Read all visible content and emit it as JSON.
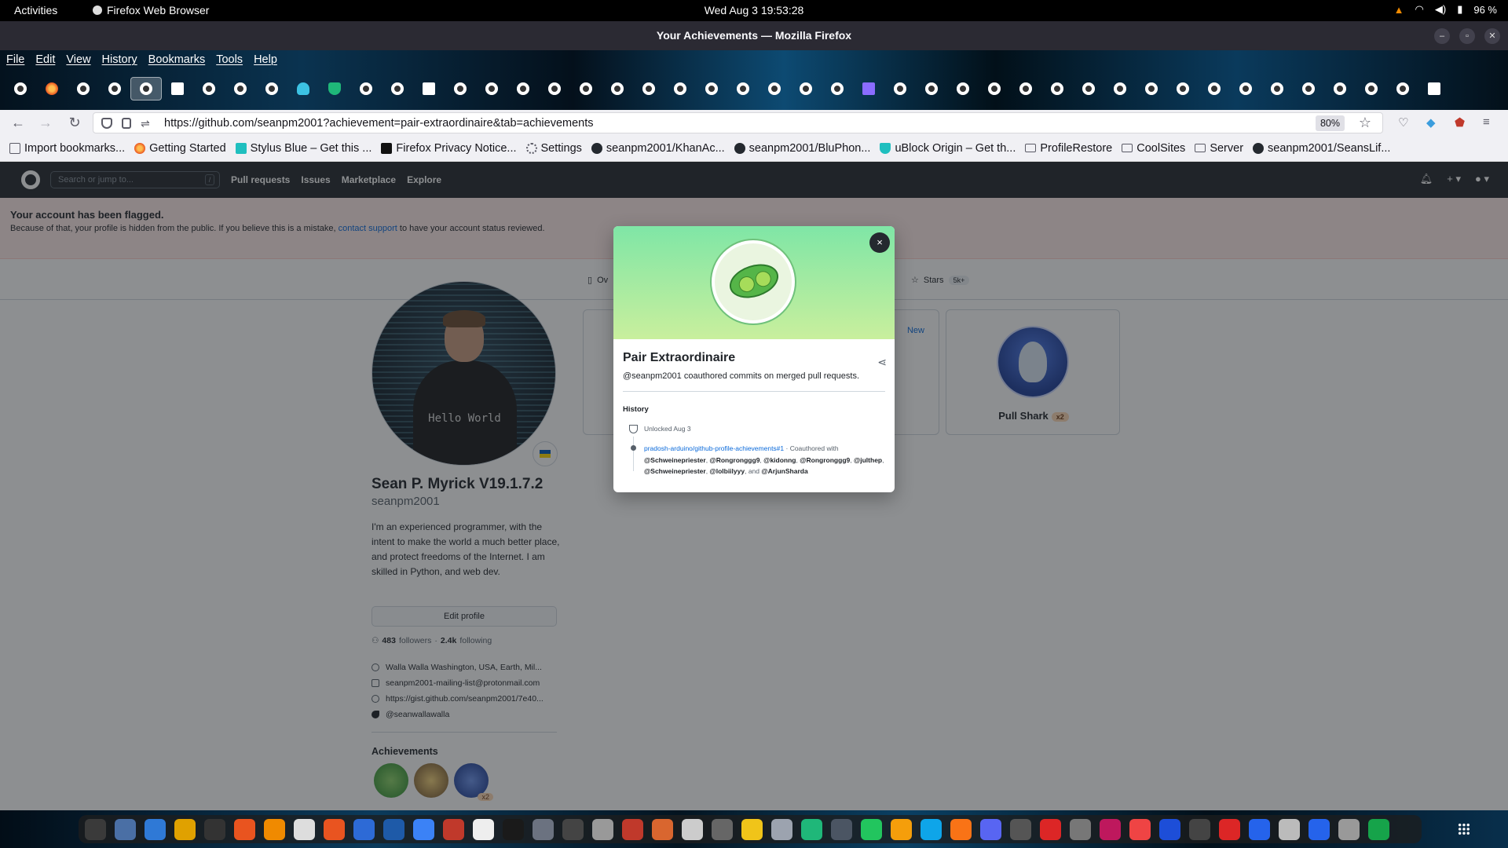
{
  "system": {
    "activities": "Activities",
    "app_name": "Firefox Web Browser",
    "clock": "Wed Aug 3  19:53:28",
    "battery": "96 %"
  },
  "window": {
    "title": "Your Achievements — Mozilla Firefox"
  },
  "menu": [
    "File",
    "Edit",
    "View",
    "History",
    "Bookmarks",
    "Tools",
    "Help"
  ],
  "tabs": [
    "github",
    "firefox",
    "github",
    "github",
    "github",
    "wikipedia",
    "github",
    "github",
    "puzzle",
    "cloud",
    "shield",
    "github",
    "github",
    "wikipedia",
    "globe",
    "github",
    "github",
    "github",
    "github",
    "github",
    "github",
    "github",
    "github",
    "github",
    "github",
    "github",
    "github",
    "mail",
    "github",
    "github",
    "github",
    "github",
    "github",
    "github",
    "github",
    "github",
    "github",
    "github",
    "github",
    "github",
    "github",
    "github",
    "github",
    "github",
    "github",
    "wikipedia"
  ],
  "active_tab_index": 4,
  "nav": {
    "url": "https://github.com/seanpm2001?achievement=pair-extraordinaire&tab=achievements",
    "zoom": "80%"
  },
  "bookmarks": [
    {
      "label": "Import bookmarks...",
      "icon": "import-icon"
    },
    {
      "label": "Getting Started",
      "icon": "firefox-icon"
    },
    {
      "label": "Stylus Blue – Get this ...",
      "icon": "stylus-icon"
    },
    {
      "label": "Firefox Privacy Notice...",
      "icon": "mozilla-icon"
    },
    {
      "label": "Settings",
      "icon": "gear-icon"
    },
    {
      "label": "seanpm2001/KhanAc...",
      "icon": "github-icon"
    },
    {
      "label": "seanpm2001/BluPhon...",
      "icon": "github-icon"
    },
    {
      "label": "uBlock Origin – Get th...",
      "icon": "ublock-icon"
    },
    {
      "label": "ProfileRestore",
      "icon": "folder-icon"
    },
    {
      "label": "CoolSites",
      "icon": "folder-icon"
    },
    {
      "label": "Server",
      "icon": "folder-icon"
    },
    {
      "label": "seanpm2001/SeansLif...",
      "icon": "github-icon"
    }
  ],
  "github": {
    "search_placeholder": "Search or jump to...",
    "search_key": "/",
    "nav": [
      "Pull requests",
      "Issues",
      "Marketplace",
      "Explore"
    ],
    "banner": {
      "title": "Your account has been flagged.",
      "text_before": "Because of that, your profile is hidden from the public. If you believe this is a mistake, ",
      "link": "contact support",
      "text_after": " to have your account status reviewed."
    },
    "tabs": {
      "overview": "Ov",
      "stars": "Stars",
      "stars_count": "5k+"
    },
    "profile": {
      "tee_text": "Hello World",
      "name": "Sean P. Myrick V19.1.7.2",
      "login": "seanpm2001",
      "bio": "I'm an experienced programmer, with the intent to make the world a much better place, and protect freedoms of the Internet. I am skilled in Python, and web dev.",
      "edit_button": "Edit profile",
      "followers": "483",
      "followers_label": "followers",
      "sep": "·",
      "following": "2.4k",
      "following_label": "following",
      "location": "Walla Walla Washington, USA, Earth, Mil...",
      "email": "seanpm2001-mailing-list@protonmail.com",
      "website": "https://gist.github.com/seanpm2001/7e40...",
      "twitter": "@seanwallawalla",
      "achievements_title": "Achievements",
      "achievement_badge_count": "x2"
    },
    "cards": {
      "new_label": "New",
      "shark_name": "Pull Shark",
      "shark_count": "x2"
    },
    "modal": {
      "title": "Pair Extraordinaire",
      "description": "@seanpm2001 coauthored commits on merged pull requests.",
      "history_label": "History",
      "unlocked": "Unlocked Aug 3",
      "pr_link": "pradosh-arduino/github-profile-achievements#1",
      "coauthored": " · Coauthored with",
      "coauthors": [
        "@Schweinepriester",
        "@Rongronggg9",
        "@kidonng",
        "@Rongronggg9",
        "@julthep",
        "@Schweinepriester",
        "@lolbiilyyy"
      ],
      "and_text": ", and ",
      "last_coauthor": "@ArjunSharda",
      "close": "×"
    }
  },
  "colors": {
    "accent_link": "#0969da",
    "banner_bg": "#ffebe9",
    "gh_header": "#24292f",
    "modal_hero_top": "#7fe6a6",
    "modal_hero_bottom": "#c9ef9d"
  }
}
